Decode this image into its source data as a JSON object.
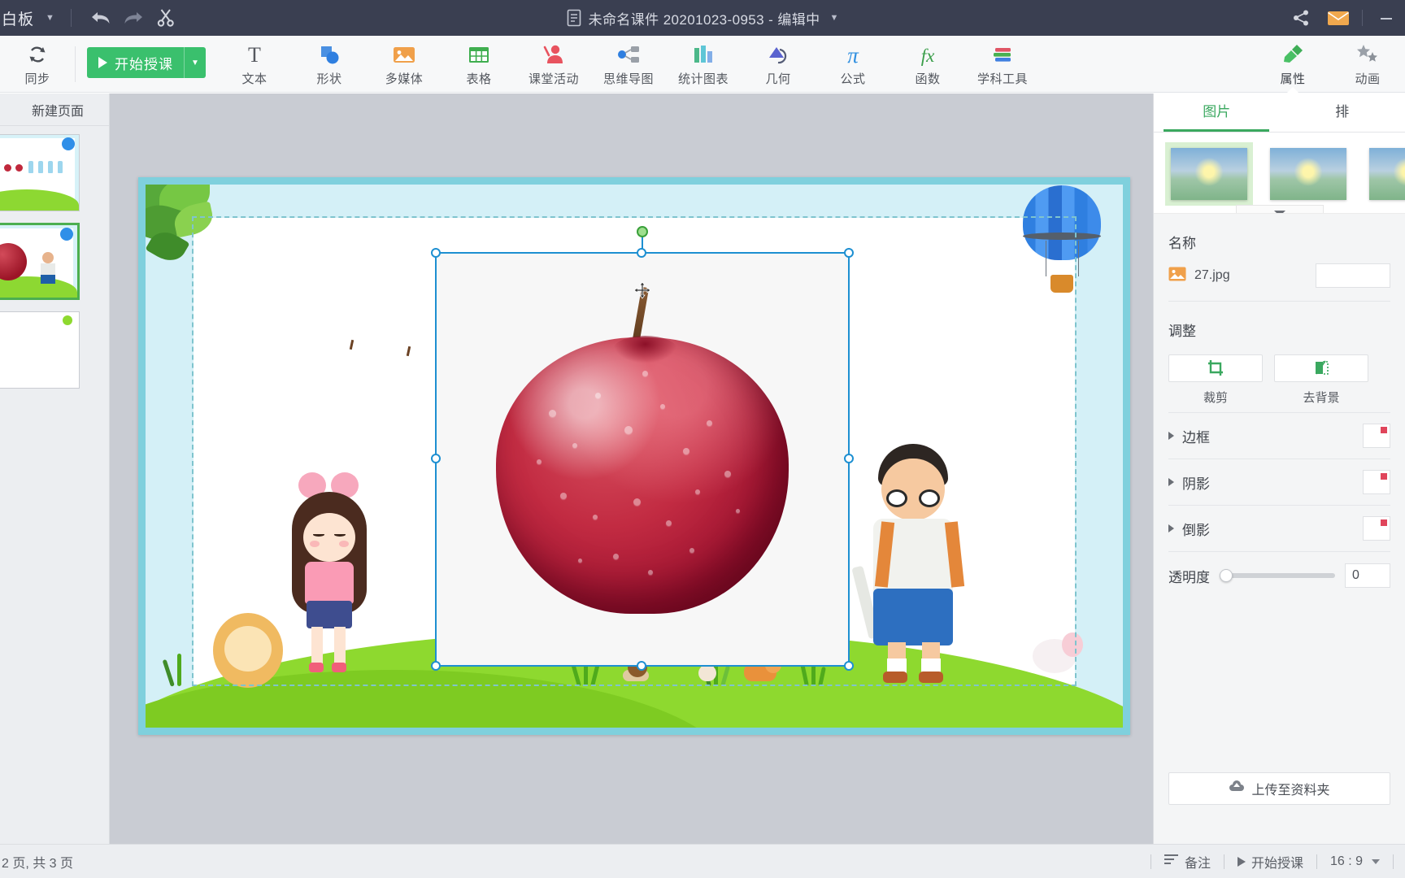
{
  "titlebar": {
    "app_menu_label": "白板",
    "doc_title": "未命名课件 20201023-0953 - 编辑中",
    "icons": {
      "undo": "undo-icon",
      "redo": "redo-icon",
      "cut": "scissors-icon",
      "share": "share-icon",
      "mail": "mail-icon",
      "minimize": "minimize-icon"
    }
  },
  "ribbon": {
    "sync_label": "同步",
    "teach_button": "开始授课",
    "items": [
      {
        "label": "文本",
        "icon": "text-icon"
      },
      {
        "label": "形状",
        "icon": "shapes-icon"
      },
      {
        "label": "多媒体",
        "icon": "media-image-icon"
      },
      {
        "label": "表格",
        "icon": "table-icon"
      },
      {
        "label": "课堂活动",
        "icon": "classroom-activity-icon"
      },
      {
        "label": "思维导图",
        "icon": "mindmap-icon"
      },
      {
        "label": "统计图表",
        "icon": "bar-chart-icon"
      },
      {
        "label": "几何",
        "icon": "geometry-icon"
      },
      {
        "label": "公式",
        "icon": "formula-pi-icon"
      },
      {
        "label": "函数",
        "icon": "function-fx-icon"
      },
      {
        "label": "学科工具",
        "icon": "subject-tools-books-icon"
      }
    ],
    "right_items": [
      {
        "label": "属性",
        "icon": "properties-brush-icon",
        "active": true
      },
      {
        "label": "动画",
        "icon": "animation-stars-icon",
        "active": false
      }
    ]
  },
  "sidebar": {
    "new_page_label": "新建页面",
    "slides": [
      {
        "index": 1,
        "selected": false
      },
      {
        "index": 2,
        "selected": true
      },
      {
        "index": 3,
        "selected": false
      }
    ]
  },
  "right_panel": {
    "tabs": [
      {
        "label": "图片",
        "active": true
      },
      {
        "label": "排",
        "active": false
      }
    ],
    "presets_count": 3,
    "name_section_label": "名称",
    "file_name": "27.jpg",
    "adjust_section_label": "调整",
    "adjust_buttons": [
      {
        "label": "裁剪",
        "icon": "crop-icon"
      },
      {
        "label": "去背景",
        "icon": "remove-background-icon"
      }
    ],
    "accordions": [
      {
        "label": "边框",
        "expanded": false
      },
      {
        "label": "阴影",
        "expanded": false
      },
      {
        "label": "倒影",
        "expanded": false
      }
    ],
    "opacity_label": "透明度",
    "opacity_value": "0",
    "upload_button": "上传至资料夹"
  },
  "statusbar": {
    "page_info": "2 页, 共 3 页",
    "notes_label": "备注",
    "teach_label": "开始授课",
    "ratio_label": "16 : 9"
  },
  "canvas": {
    "selected_object": "apple-image",
    "cursor": "move-cursor"
  },
  "colors": {
    "titlebar_bg": "#3a3f51",
    "ribbon_bg": "#f7f8f9",
    "accent_green": "#3ac06d",
    "panel_accent": "#3aa85f",
    "selection_blue": "#1d8fd1",
    "workspace_bg": "#c9ccd3",
    "slide_sky": "#d4f0f7",
    "slide_grass": "#8ed92f"
  }
}
